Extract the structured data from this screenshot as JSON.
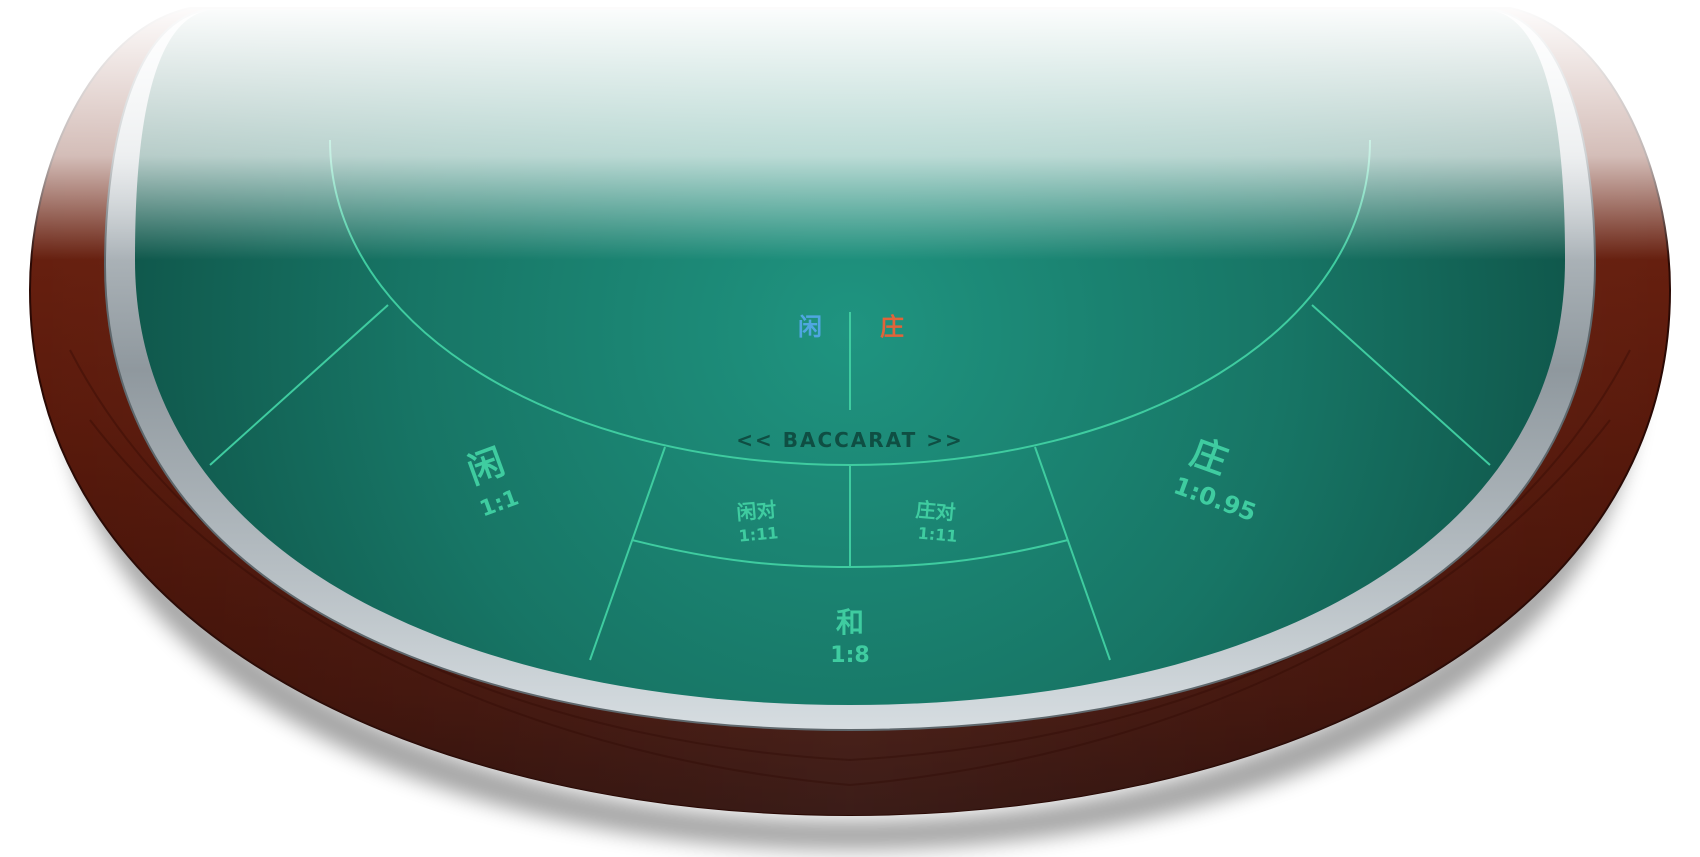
{
  "table": {
    "name": "<< BACCARAT >>",
    "colors": {
      "felt": "#1b8a76",
      "line": "#3fcca0",
      "wood": "#6b1e10",
      "rail": "#b9c0c6",
      "player": "#4fa6e0",
      "banker": "#e0643a"
    }
  },
  "scoreboard": {
    "player_label": "闲",
    "banker_label": "庄"
  },
  "bets": {
    "player": {
      "label": "闲",
      "odds": "1:1"
    },
    "player_pair": {
      "label": "闲对",
      "odds": "1:11"
    },
    "banker_pair": {
      "label": "庄对",
      "odds": "1:11"
    },
    "banker": {
      "label": "庄",
      "odds": "1:0.95"
    },
    "tie": {
      "label": "和",
      "odds": "1:8"
    }
  }
}
